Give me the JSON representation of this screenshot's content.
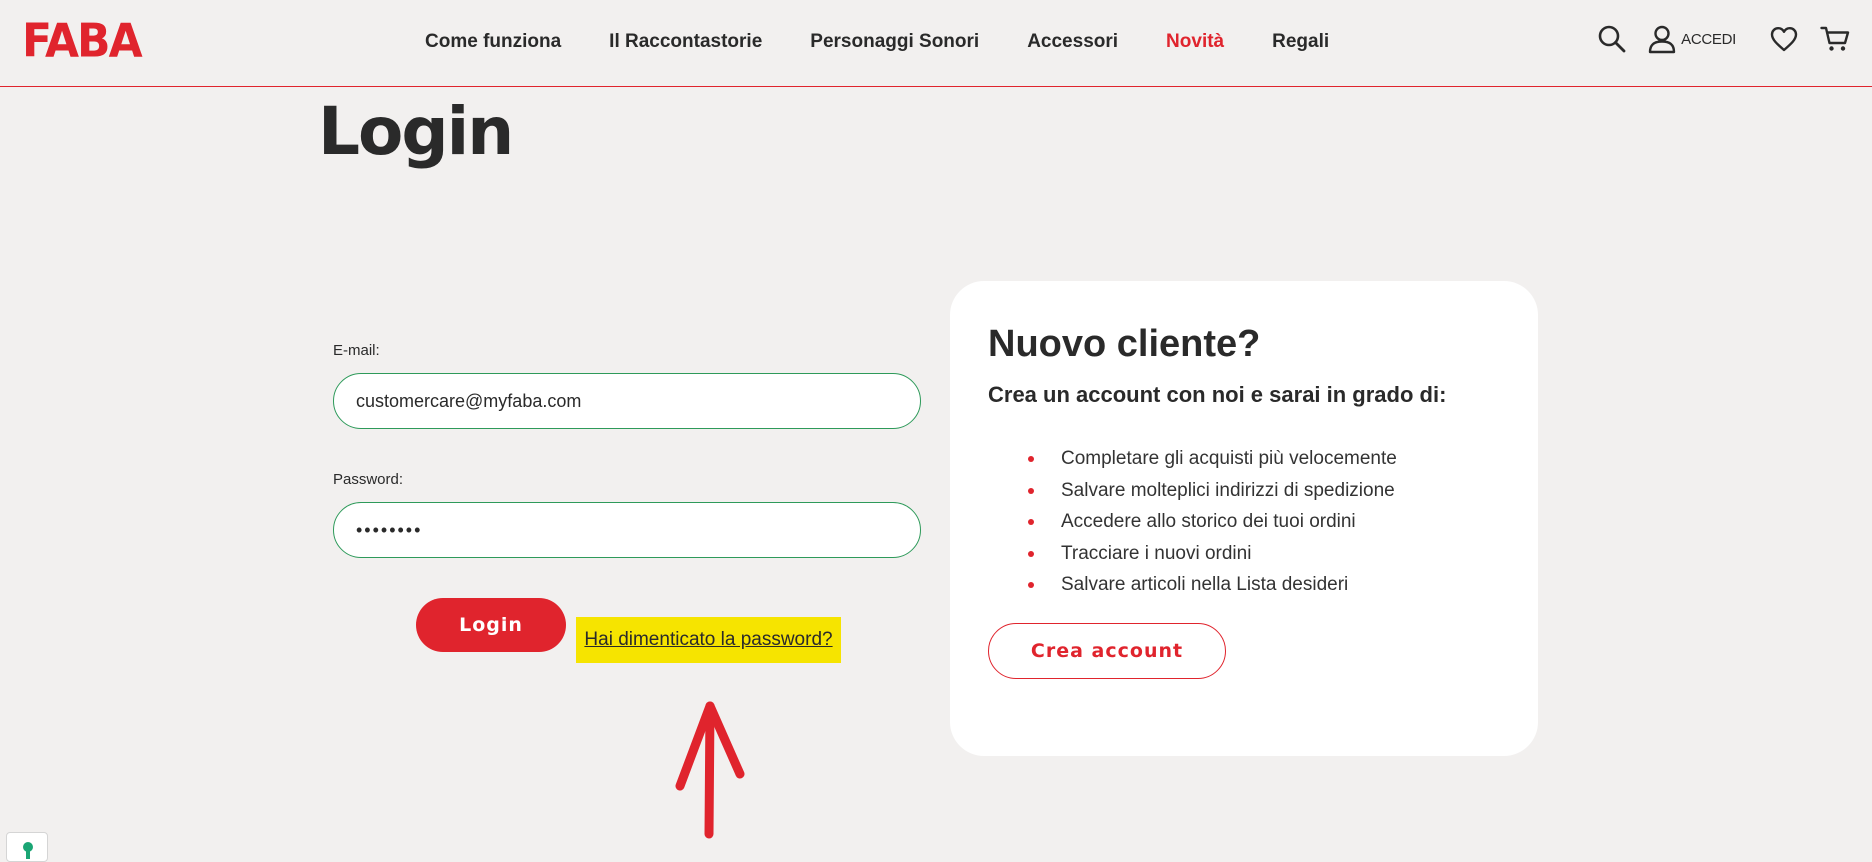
{
  "brand": {
    "logo_text": "FABA",
    "accent_color": "#e0242d",
    "field_border_color": "#2e9a5a",
    "highlight_color": "#f6e400"
  },
  "nav": {
    "items": [
      {
        "label": "Come funziona",
        "active": false
      },
      {
        "label": "Il Raccontastorie",
        "active": false
      },
      {
        "label": "Personaggi Sonori",
        "active": false
      },
      {
        "label": "Accessori",
        "active": false
      },
      {
        "label": "Novità",
        "active": true
      },
      {
        "label": "Regali",
        "active": false
      }
    ]
  },
  "header_icons": {
    "search": "search-icon",
    "account": "user-icon",
    "account_label": "ACCEDI",
    "wishlist": "heart-icon",
    "cart": "cart-icon"
  },
  "page": {
    "title": "Login"
  },
  "login_form": {
    "email_label": "E-mail:",
    "email_value": "customercare@myfaba.com",
    "password_label": "Password:",
    "password_value": "••••••••",
    "login_button": "Login",
    "forgot_link": "Hai dimenticato la password?"
  },
  "new_customer": {
    "title": "Nuovo cliente?",
    "subtitle": "Crea un account con noi e sarai in grado di:",
    "benefits": [
      "Completare gli acquisti più velocemente",
      "Salvare molteplici indirizzi di spedizione",
      "Accedere allo storico dei tuoi ordini",
      "Tracciare i nuovi ordini",
      "Salvare articoli nella Lista desideri"
    ],
    "create_button": "Crea account"
  },
  "annotation": {
    "arrow_icon": "arrow-up-icon"
  },
  "widgets": {
    "privacy": "privacy-settings-icon"
  }
}
